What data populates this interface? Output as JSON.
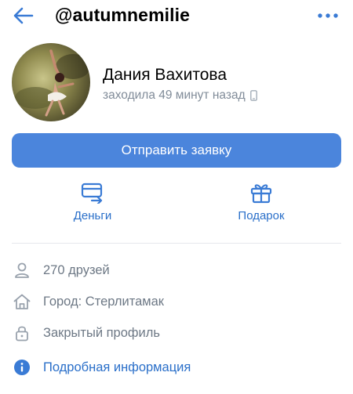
{
  "header": {
    "username": "@autumnemilie",
    "back_icon": "arrow-left-icon",
    "more_icon": "more-horizontal-icon"
  },
  "profile": {
    "name": "Дания Вахитова",
    "status": "заходила 49 минут назад",
    "status_icon": "mobile-phone-icon"
  },
  "primary_action": {
    "label": "Отправить заявку",
    "color": "#4b85dc"
  },
  "actions": [
    {
      "label": "Деньги",
      "icon": "money-transfer-icon"
    },
    {
      "label": "Подарок",
      "icon": "gift-icon"
    }
  ],
  "info": {
    "friends": "270 друзей",
    "city": "Город: Стерлитамак",
    "privacy": "Закрытый профиль",
    "details_link": "Подробная информация"
  },
  "colors": {
    "accent": "#2a6fc9",
    "muted_text": "#6d7885",
    "status_text": "#818c99"
  }
}
